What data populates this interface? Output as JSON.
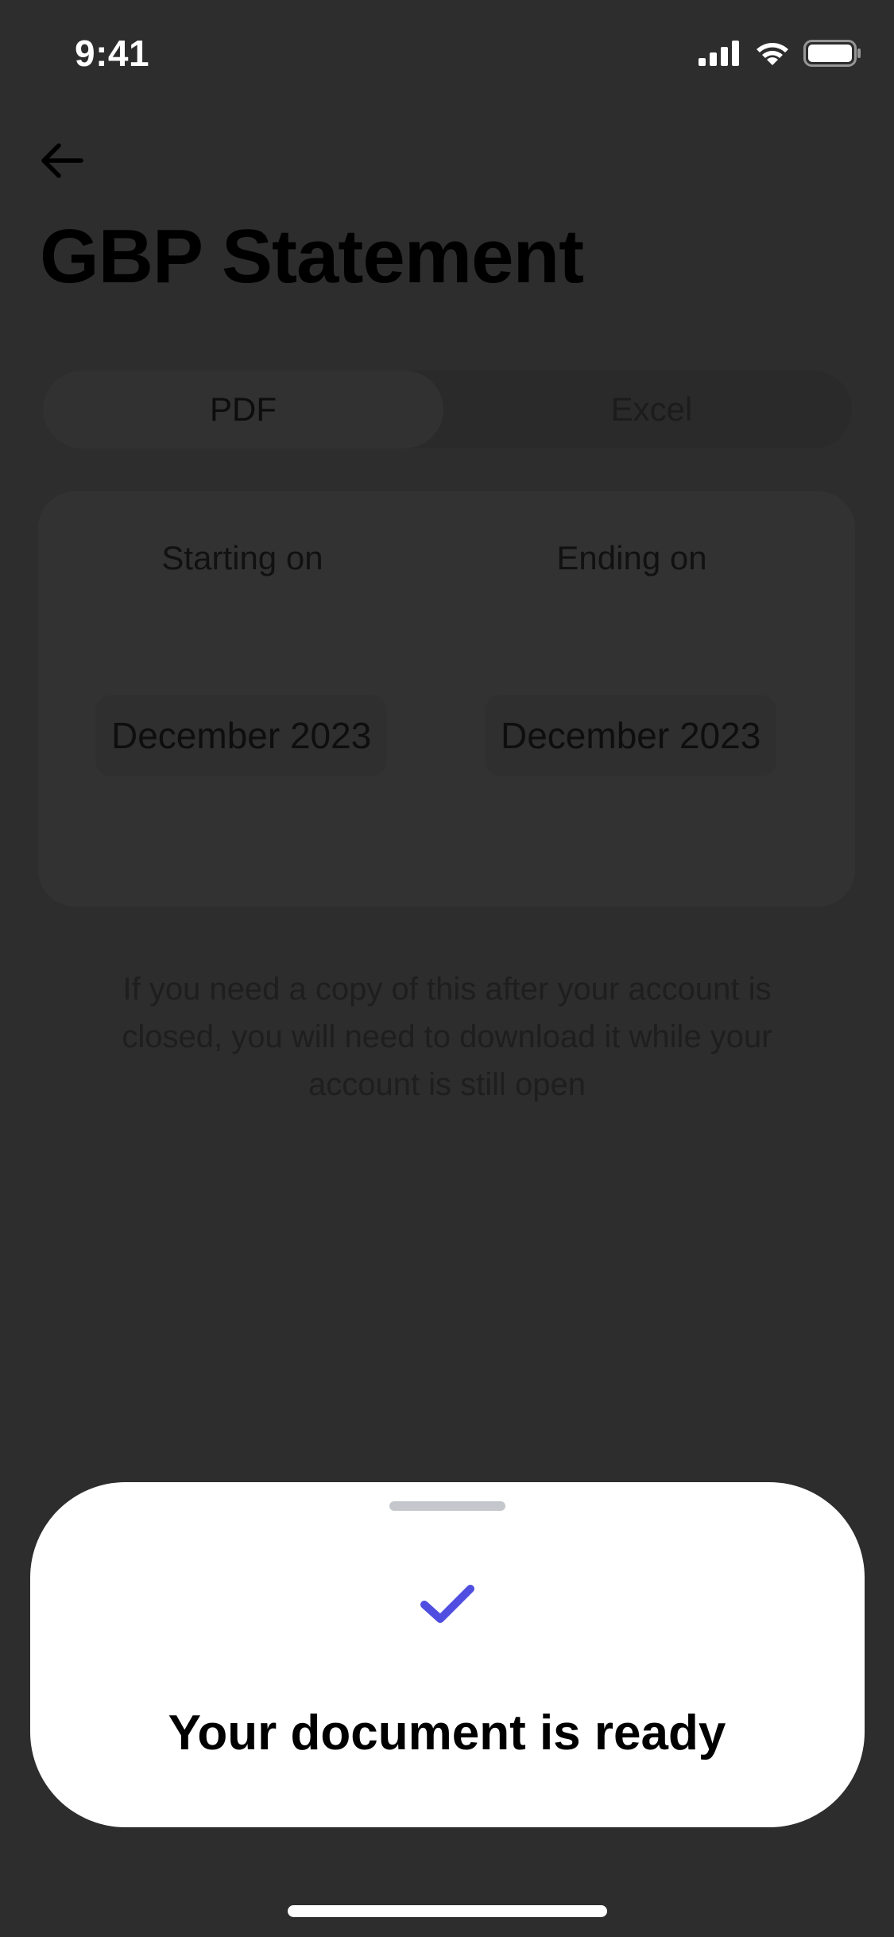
{
  "status_bar": {
    "time": "9:41",
    "icons": [
      "signal-icon",
      "wifi-icon",
      "battery-icon"
    ]
  },
  "header": {
    "back_icon": "arrow-left-icon",
    "title": "GBP Statement"
  },
  "format_tabs": {
    "items": [
      {
        "label": "PDF",
        "selected": true
      },
      {
        "label": "Excel",
        "selected": false
      }
    ]
  },
  "date_range": {
    "start": {
      "label": "Starting on",
      "value": "December 2023"
    },
    "end": {
      "label": "Ending on",
      "value": "December 2023"
    }
  },
  "info": {
    "text": "If you need a copy of this after your account is closed, you will need to download it while your account is still open"
  },
  "sheet": {
    "icon": "checkmark-icon",
    "title": "Your document is ready",
    "accent_color": "#4f4ee0"
  }
}
